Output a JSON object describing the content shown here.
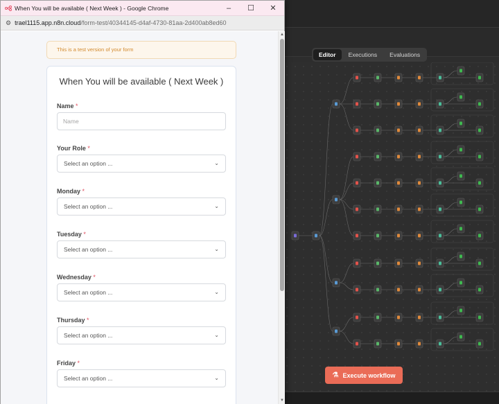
{
  "browser": {
    "window_title": "When You will be available ( Next Week ) - Google Chrome",
    "minimize_label": "–",
    "maximize_label": "☐",
    "close_label": "✕",
    "url_host": "trael1115.app.n8n.cloud",
    "url_path": "/form-test/40344145-d4af-4730-81aa-2d400ab8ed60"
  },
  "form": {
    "notice": "This is a test version of your form",
    "title": "When You will be available ( Next Week )",
    "name_label": "Name",
    "name_placeholder": "Name",
    "required_marker": "*",
    "select_placeholder": "Select an option ...",
    "fields": [
      {
        "label": "Your Role"
      },
      {
        "label": "Monday"
      },
      {
        "label": "Tuesday"
      },
      {
        "label": "Wednesday"
      },
      {
        "label": "Thursday"
      },
      {
        "label": "Friday"
      }
    ]
  },
  "editor": {
    "tabs": [
      "Editor",
      "Executions",
      "Evaluations"
    ],
    "active_tab": "Editor",
    "execute_label": "Execute workflow"
  },
  "colors": {
    "accent": "#ea6c57",
    "required": "#e05060",
    "notice_text": "#d28a2f"
  },
  "icons": {
    "favicon": "n8n-form-icon",
    "site_info": "tune-icon",
    "select_chevron": "chevron-down-icon",
    "execute": "flask-icon"
  }
}
